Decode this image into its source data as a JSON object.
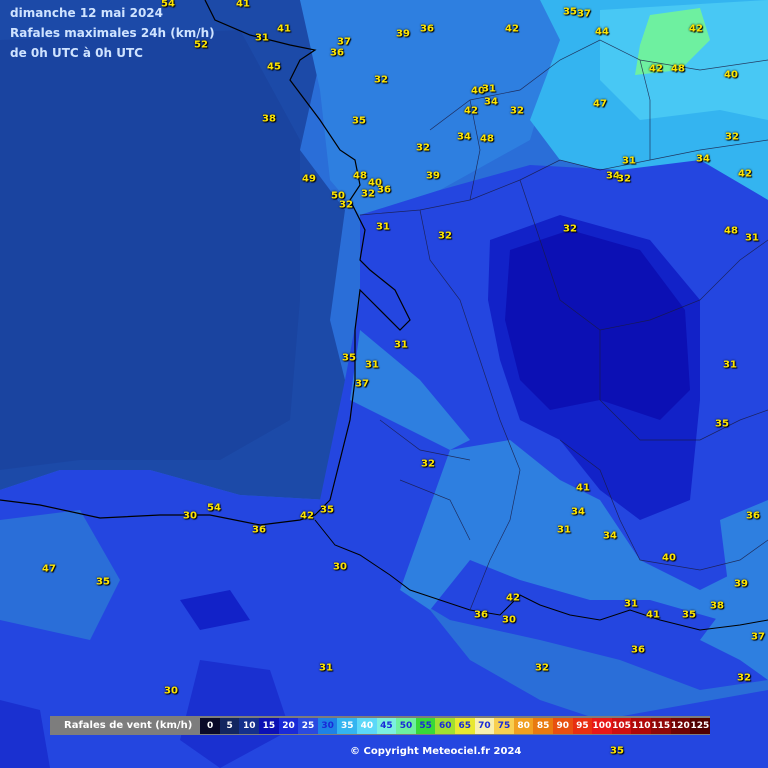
{
  "header": {
    "line1": "dimanche 12 mai 2024",
    "line2": "Rafales maximales 24h (km/h)",
    "line3": "de 0h UTC à 0h UTC"
  },
  "legend": {
    "title": "Rafales de vent (km/h)",
    "steps": [
      {
        "label": "0",
        "color": "#0a0a28",
        "text": "#ffffff"
      },
      {
        "label": "5",
        "color": "#122660",
        "text": "#ffffff"
      },
      {
        "label": "10",
        "color": "#14308c",
        "text": "#ffffff"
      },
      {
        "label": "15",
        "color": "#0c10b4",
        "text": "#ffffff"
      },
      {
        "label": "20",
        "color": "#1a2ad8",
        "text": "#ffffff"
      },
      {
        "label": "25",
        "color": "#2a4ae0",
        "text": "#ffffff"
      },
      {
        "label": "30",
        "color": "#1e82e6",
        "text": "#1a2ad8"
      },
      {
        "label": "35",
        "color": "#34b4f0",
        "text": "#ffffff"
      },
      {
        "label": "40",
        "color": "#5cd8f8",
        "text": "#ffffff"
      },
      {
        "label": "45",
        "color": "#7cf0e0",
        "text": "#1a2ad8"
      },
      {
        "label": "50",
        "color": "#6ef0a0",
        "text": "#1a2ad8"
      },
      {
        "label": "55",
        "color": "#38d838",
        "text": "#1a2ad8"
      },
      {
        "label": "60",
        "color": "#a0e030",
        "text": "#1a2ad8"
      },
      {
        "label": "65",
        "color": "#e8e830",
        "text": "#1a2ad8"
      },
      {
        "label": "70",
        "color": "#f8f0b0",
        "text": "#1a2ad8"
      },
      {
        "label": "75",
        "color": "#f8d050",
        "text": "#1a2ad8"
      },
      {
        "label": "80",
        "color": "#f0a020",
        "text": "#ffffff"
      },
      {
        "label": "85",
        "color": "#e87a10",
        "text": "#ffffff"
      },
      {
        "label": "90",
        "color": "#e85010",
        "text": "#ffffff"
      },
      {
        "label": "95",
        "color": "#e83010",
        "text": "#ffffff"
      },
      {
        "label": "100",
        "color": "#e81818",
        "text": "#ffffff"
      },
      {
        "label": "105",
        "color": "#d01010",
        "text": "#ffffff"
      },
      {
        "label": "110",
        "color": "#b00808",
        "text": "#ffffff"
      },
      {
        "label": "115",
        "color": "#900808",
        "text": "#ffffff"
      },
      {
        "label": "120",
        "color": "#700404",
        "text": "#ffffff"
      },
      {
        "label": "125",
        "color": "#500000",
        "text": "#ffffff"
      }
    ]
  },
  "copyright": "© Copyright Meteociel.fr 2024",
  "values": [
    "54",
    "41",
    "52",
    "31",
    "41",
    "37",
    "36",
    "39",
    "36",
    "42",
    "35",
    "37",
    "44",
    "42",
    "42",
    "48",
    "40",
    "45",
    "32",
    "40",
    "31",
    "34",
    "42",
    "32",
    "47",
    "38",
    "35",
    "34",
    "48",
    "32",
    "32",
    "31",
    "34",
    "34",
    "32",
    "42",
    "49",
    "48",
    "40",
    "36",
    "50",
    "32",
    "32",
    "39",
    "31",
    "32",
    "32",
    "48",
    "31",
    "35",
    "31",
    "31",
    "37",
    "31",
    "35",
    "32",
    "41",
    "34",
    "54",
    "30",
    "35",
    "42",
    "36",
    "31",
    "34",
    "36",
    "40",
    "47",
    "35",
    "30",
    "42",
    "36",
    "30",
    "31",
    "41",
    "35",
    "38",
    "39",
    "36",
    "37",
    "31",
    "32",
    "30",
    "32",
    "35"
  ]
}
